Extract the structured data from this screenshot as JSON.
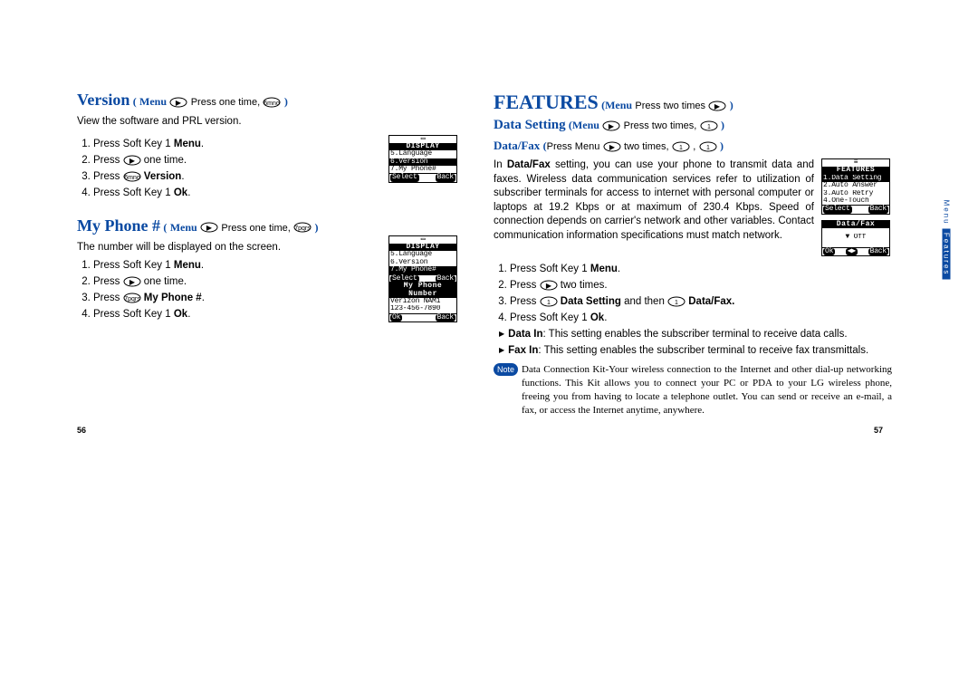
{
  "left": {
    "version": {
      "title": "Version",
      "nav_menu": "Menu",
      "nav_action": "Press one time,",
      "desc": "View the software and PRL version.",
      "steps": [
        {
          "pre": "Press Soft Key 1 ",
          "bold": "Menu",
          "post": "."
        },
        {
          "pre": "Press ",
          "icon": "right",
          "post": " one time."
        },
        {
          "pre": "Press ",
          "icon": "6",
          "bold": " Version",
          "post": "."
        },
        {
          "pre": "Press Soft Key 1 ",
          "bold": "Ok",
          "post": "."
        }
      ],
      "screen": {
        "title": "DISPLAY",
        "rows": [
          "5.Language",
          "6.Version",
          "7.My Phone#"
        ],
        "softkeys": [
          "Select",
          "Back"
        ]
      }
    },
    "myphone": {
      "title": "My Phone #",
      "nav_menu": "Menu",
      "nav_action": "Press one time,",
      "desc": "The number will be displayed on the screen.",
      "steps": [
        {
          "pre": "Press Soft Key 1 ",
          "bold": "Menu",
          "post": "."
        },
        {
          "pre": "Press ",
          "icon": "right",
          "post": " one time."
        },
        {
          "pre": "Press ",
          "icon": "7",
          "bold": " My Phone #",
          "post": "."
        },
        {
          "pre": "Press Soft Key 1 ",
          "bold": "Ok",
          "post": "."
        }
      ],
      "screen1": {
        "title": "DISPLAY",
        "rows": [
          "5.Language",
          "6.Version",
          "7.My Phone#"
        ],
        "softkeys": [
          "Select",
          "Back"
        ]
      },
      "screen2": {
        "title": "My Phone Number",
        "rows": [
          "Verizon NAM1",
          "123-456-7890"
        ],
        "softkeys": [
          "Ok",
          "Back"
        ]
      }
    },
    "page_num": "56"
  },
  "right": {
    "features_title": "FEATURES",
    "features_nav_menu": "Menu",
    "features_nav_action": "Press two times",
    "data_setting_title": "Data Setting",
    "data_setting_nav_menu": "Menu",
    "data_setting_nav_action": "Press two times,",
    "datafax_title": "Data/Fax",
    "datafax_nav_pre": "Press Menu",
    "datafax_nav_mid": "two times,",
    "body": "In Data/Fax setting, you can use your phone to transmit data and faxes. Wireless data communication services refer to utilization of subscriber terminals for access to internet with personal computer or laptops at 19.2 Kbps or at maximum of 230.4 Kbps. Speed of connection depends on carrier's network and other variables. Contact communication information specifications must match network.",
    "body_bold_lead": "Data/Fax",
    "steps": [
      {
        "pre": "Press Soft Key 1 ",
        "bold": "Menu",
        "post": "."
      },
      {
        "pre": "Press ",
        "icon": "right",
        "post": " two times."
      },
      {
        "pre": "Press ",
        "icon": "1",
        "bold": " Data Setting",
        "mid": " and then ",
        "icon2": "1",
        "bold2": " Data/Fax.",
        "post": ""
      },
      {
        "pre": "Press Soft Key 1 ",
        "bold": "Ok",
        "post": "."
      }
    ],
    "items": [
      {
        "label": "Data In",
        "text": ": This setting enables the subscriber terminal to receive data calls."
      },
      {
        "label": "Fax In",
        "text": ": This setting enables the subscriber terminal to receive fax transmittals."
      }
    ],
    "note_label": "Note",
    "note_text": "Data Connection Kit-Your wireless connection to the Internet and other dial-up networking functions. This Kit allows you to connect your PC or PDA to your LG wireless phone, freeing you from having to locate a telephone outlet. You can send or receive an e-mail, a fax, or access the Internet anytime, anywhere.",
    "screen1": {
      "title": "FEATURES",
      "rows": [
        "1.Data Setting",
        "2.Auto Answer",
        "3.Auto Retry",
        "4.One-Touch"
      ],
      "softkeys": [
        "Select",
        "Back"
      ]
    },
    "screen2": {
      "title": "Data/Fax",
      "value": "▼ Off",
      "softkeys": [
        "Ok",
        "",
        "Back"
      ]
    },
    "tab": {
      "pre": "Menu",
      "hl": "Features"
    },
    "page_num": "57"
  }
}
